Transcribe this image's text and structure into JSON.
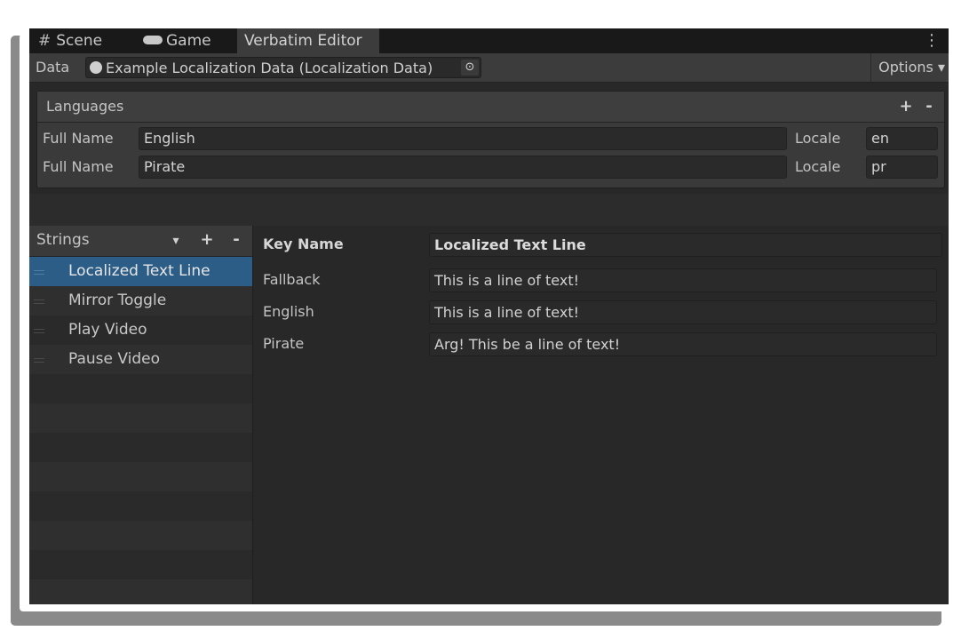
{
  "tabs": [
    {
      "label": "Scene",
      "icon": "grid-icon",
      "glyph": "#"
    },
    {
      "label": "Game",
      "icon": "gamepad-icon",
      "glyph": "◉"
    },
    {
      "label": "Verbatim Editor",
      "icon": "",
      "glyph": ""
    }
  ],
  "tab_menu_glyph": "⋮",
  "data_row": {
    "label": "Data",
    "object_value": "Example Localization Data (Localization Data)",
    "picker_glyph": "⊙",
    "options_label": "Options",
    "options_arrow": "▾"
  },
  "languages": {
    "title": "Languages",
    "add_glyph": "+",
    "remove_glyph": "-",
    "rows": [
      {
        "full_name_label": "Full Name",
        "full_name": "English",
        "locale_label": "Locale",
        "locale": "en"
      },
      {
        "full_name_label": "Full Name",
        "full_name": "Pirate",
        "locale_label": "Locale",
        "locale": "pr"
      }
    ]
  },
  "strings": {
    "title": "Strings",
    "dropdown_glyph": "▾",
    "add_glyph": "+",
    "remove_glyph": "-",
    "items": [
      {
        "label": "Localized Text Line",
        "selected": true
      },
      {
        "label": "Mirror Toggle",
        "selected": false
      },
      {
        "label": "Play Video",
        "selected": false
      },
      {
        "label": "Pause Video",
        "selected": false
      }
    ]
  },
  "detail": {
    "key_label": "Key Name",
    "key_value": "Localized Text Line",
    "entries": [
      {
        "label": "Fallback",
        "value": "This is a line of text!"
      },
      {
        "label": "English",
        "value": "This is a line of text!"
      },
      {
        "label": "Pirate",
        "value": "Arg! This be a line of text!"
      }
    ]
  },
  "colors": {
    "selection": "#2c5d87",
    "background": "#282828",
    "tabbar": "#191919"
  }
}
